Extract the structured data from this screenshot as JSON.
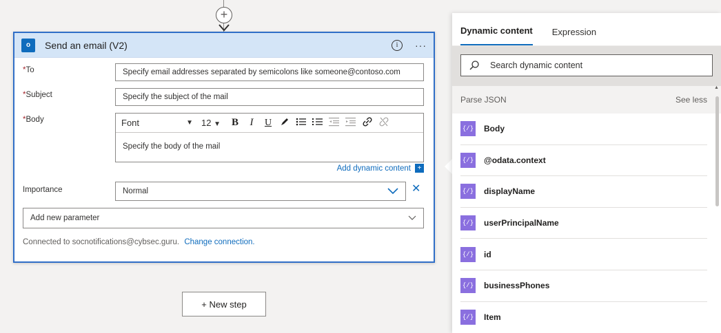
{
  "card": {
    "title": "Send an email (V2)",
    "info_glyph": "i",
    "more_glyph": "···",
    "icon_text": "o",
    "fields": {
      "to_label": "To",
      "to_placeholder": "Specify email addresses separated by semicolons like someone@contoso.com",
      "subject_label": "Subject",
      "subject_placeholder": "Specify the subject of the mail",
      "body_label": "Body",
      "body_placeholder": "Specify the body of the mail",
      "required_mark": "*"
    },
    "toolbar": {
      "font": "Font",
      "size": "12",
      "bold": "B",
      "italic": "I",
      "underline": "U"
    },
    "add_dynamic_content": "Add dynamic content",
    "importance_label": "Importance",
    "importance_value": "Normal",
    "add_new_parameter": "Add new parameter",
    "connected_text": "Connected to socnotifications@cybsec.guru.",
    "change_connection": "Change connection."
  },
  "new_step": "+ New step",
  "panel": {
    "tabs": [
      "Dynamic content",
      "Expression"
    ],
    "search_placeholder": "Search dynamic content",
    "section_title": "Parse JSON",
    "see_less": "See less",
    "items": [
      {
        "label": "Body"
      },
      {
        "label": "@odata.context"
      },
      {
        "label": "displayName"
      },
      {
        "label": "userPrincipalName"
      },
      {
        "label": "id"
      },
      {
        "label": "businessPhones"
      },
      {
        "label": "Item"
      }
    ]
  },
  "colors": {
    "accent": "#0f6cbd",
    "card_header": "#d4e5f7",
    "card_border": "#2f6ec7",
    "dynamic_icon": "#8a6fdf"
  },
  "icons": {
    "add": "plus-circle-icon",
    "search": "search-icon",
    "item": "braces-icon"
  }
}
